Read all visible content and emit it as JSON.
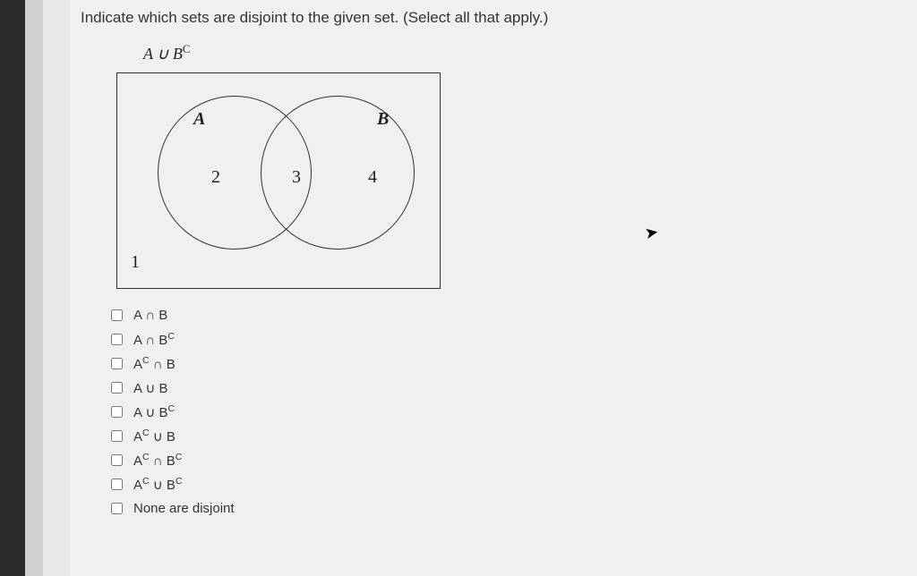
{
  "question": "Indicate which sets are disjoint to the given set. (Select all that apply.)",
  "given_set": {
    "prefix": "A ∪ B",
    "sup": "C"
  },
  "diagram": {
    "circleA": "A",
    "circleB": "B",
    "region1": "1",
    "region2": "2",
    "region3": "3",
    "region4": "4"
  },
  "options": [
    {
      "html": "A ∩ B"
    },
    {
      "html": "A ∩ B<sup class='sup'>C</sup>"
    },
    {
      "html": "A<sup class='sup'>C</sup> ∩ B"
    },
    {
      "html": "A ∪ B"
    },
    {
      "html": "A ∪ B<sup class='sup'>C</sup>"
    },
    {
      "html": "A<sup class='sup'>C</sup> ∪ B"
    },
    {
      "html": "A<sup class='sup'>C</sup> ∩ B<sup class='sup'>C</sup>"
    },
    {
      "html": "A<sup class='sup'>C</sup> ∪ B<sup class='sup'>C</sup>"
    },
    {
      "html": "None are disjoint"
    }
  ]
}
